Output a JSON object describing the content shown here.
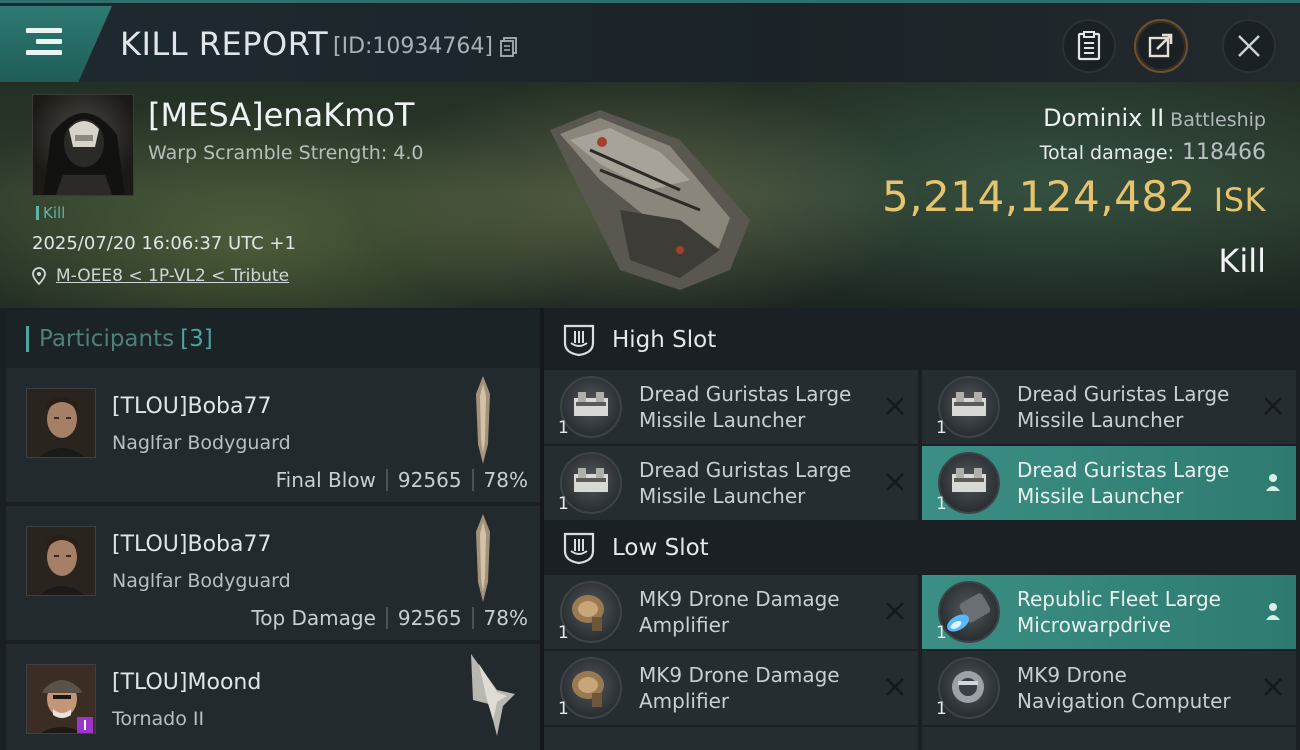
{
  "header": {
    "title": "KILL REPORT",
    "report_id": "[ID:10934764]"
  },
  "victim": {
    "name": "[MESA]enaKmoT",
    "warp_scramble": "Warp Scramble Strength: 4.0",
    "event_tag": "Kill",
    "datetime": "2025/07/20 16:06:37 UTC +1",
    "location": "M-OEE8 < 1P-VL2 < Tribute",
    "ship_name": "Dominix II",
    "ship_class": "Battleship",
    "total_damage_label": "Total damage:",
    "total_damage_value": "118466",
    "isk_value": "5,214,124,482",
    "isk_unit": "ISK",
    "status": "Kill"
  },
  "participants": {
    "label": "Participants",
    "count": "[3]",
    "items": [
      {
        "name": "[TLOU]Boba77",
        "ship": "Naglfar Bodyguard",
        "role": "Final Blow",
        "damage": "92565",
        "percent": "78%"
      },
      {
        "name": "[TLOU]Boba77",
        "ship": "Naglfar Bodyguard",
        "role": "Top Damage",
        "damage": "92565",
        "percent": "78%"
      },
      {
        "name": "[TLOU]Moond",
        "ship": "Tornado II"
      }
    ]
  },
  "fitting": {
    "high_slot": {
      "label": "High Slot",
      "modules": [
        {
          "qty": "1",
          "line1": "Dread Guristas Large",
          "line2": "Missile Launcher",
          "state": "destroyed"
        },
        {
          "qty": "1",
          "line1": "Dread Guristas Large",
          "line2": "Missile Launcher",
          "state": "destroyed"
        },
        {
          "qty": "1",
          "line1": "Dread Guristas Large",
          "line2": "Missile Launcher",
          "state": "destroyed"
        },
        {
          "qty": "1",
          "line1": "Dread Guristas Large",
          "line2": "Missile Launcher",
          "state": "dropped"
        }
      ]
    },
    "low_slot": {
      "label": "Low Slot",
      "modules": [
        {
          "qty": "1",
          "line1": "MK9 Drone Damage",
          "line2": "Amplifier",
          "state": "destroyed"
        },
        {
          "qty": "1",
          "line1": "Republic Fleet Large",
          "line2": "Microwarpdrive",
          "state": "dropped"
        },
        {
          "qty": "1",
          "line1": "MK9 Drone Damage",
          "line2": "Amplifier",
          "state": "destroyed"
        },
        {
          "qty": "1",
          "line1": "MK9 Drone",
          "line2": "Navigation Computer",
          "state": "destroyed"
        }
      ]
    }
  },
  "colors": {
    "accent_teal": "#4aa59c",
    "isk_gold": "#e7c46b",
    "highlight_row": "#3b8f84"
  }
}
